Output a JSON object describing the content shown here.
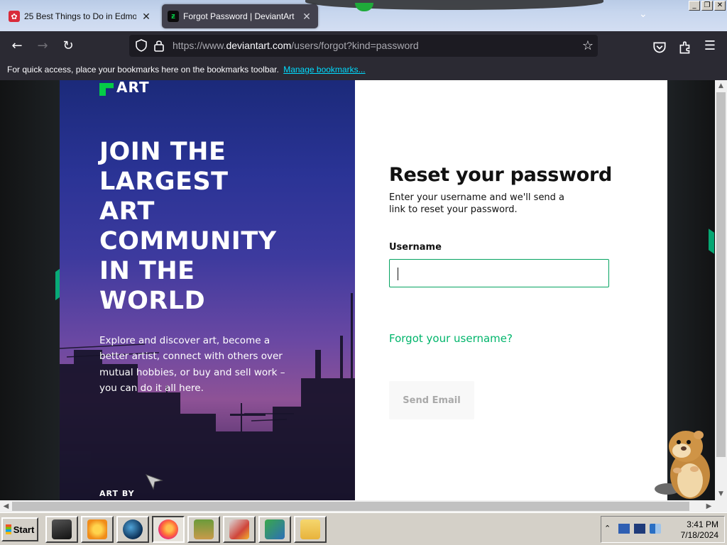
{
  "browser": {
    "tabs": [
      {
        "title": "25 Best Things to Do in Edmonton",
        "active": false,
        "favicon": "red-maple-icon"
      },
      {
        "title": "Forgot Password | DeviantArt",
        "active": true,
        "favicon": "deviantart-icon"
      }
    ],
    "url_prefix": "https://www.",
    "url_host": "deviantart.com",
    "url_path": "/users/forgot?kind=password",
    "bookmarks_message": "For quick access, place your bookmarks here on the bookmarks toolbar.",
    "bookmarks_link": "Manage bookmarks..."
  },
  "hero": {
    "logo_text": "ART",
    "title_lines": [
      "JOIN THE",
      "LARGEST",
      "ART",
      "COMMUNITY",
      "IN THE",
      "WORLD"
    ],
    "description": "Explore and discover art, become a better artist, connect with others over mutual hobbies, or buy and sell work – you can do it all here.",
    "art_by": "ART BY"
  },
  "form": {
    "heading": "Reset your password",
    "subtext": "Enter your username and we'll send a link to reset your password.",
    "username_label": "Username",
    "username_value": "",
    "forgot_username": "Forgot your username?",
    "send_button": "Send Email"
  },
  "taskbar": {
    "start_label": "Start",
    "time": "3:41 PM",
    "date": "7/18/2024"
  },
  "colors": {
    "accent_green": "#05cc47",
    "link_green": "#00b56b",
    "field_border": "#05a361",
    "browser_chrome": "#2b2a33"
  }
}
